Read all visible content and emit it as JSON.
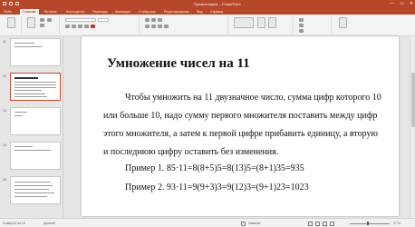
{
  "window": {
    "title": "Презентация1 – PowerPoint",
    "minimize_glyph": "—",
    "maximize_glyph": "▭",
    "close_glyph": "✕"
  },
  "ribbon_tabs": [
    {
      "label": "Файл"
    },
    {
      "label": "Главная"
    },
    {
      "label": "Вставка"
    },
    {
      "label": "Конструктор"
    },
    {
      "label": "Переходы"
    },
    {
      "label": "Анимация"
    },
    {
      "label": "Слайд-шоу"
    },
    {
      "label": "Рецензирование"
    },
    {
      "label": "Вид"
    },
    {
      "label": "Справка"
    }
  ],
  "thumbnails": [
    {
      "number": "11",
      "caption": "Примеры чисел"
    },
    {
      "number": "12",
      "caption": "Умножение чисел на 11"
    },
    {
      "number": "13",
      "caption": "Упражнение"
    },
    {
      "number": "14",
      "caption": "Примеры чисел"
    },
    {
      "number": "15",
      "caption": ""
    }
  ],
  "slide": {
    "title": "Умножение чисел на 11",
    "paragraph": "Чтобы умножить на 11 двузначное число, сумма цифр которого 10 или больше 10, надо сумму первого множителя поставить между цифр этого множителя, а затем к первой цифре прибавить единицу, а вторую и последнюю цифру оставить без изменения.",
    "example1": "Пример 1. 85·11=8(8+5)5=8(13)5=(8+1)35=935",
    "example2": "Пример 2. 93·11=9(9+3)3=9(12)3=(9+1)23=1023"
  },
  "status": {
    "slide_indicator": "Слайд 12 из 19",
    "language": "русский",
    "notes": "Заметки",
    "zoom": "97 %"
  },
  "colors": {
    "accent": "#b7472a",
    "selection": "#d24726"
  }
}
